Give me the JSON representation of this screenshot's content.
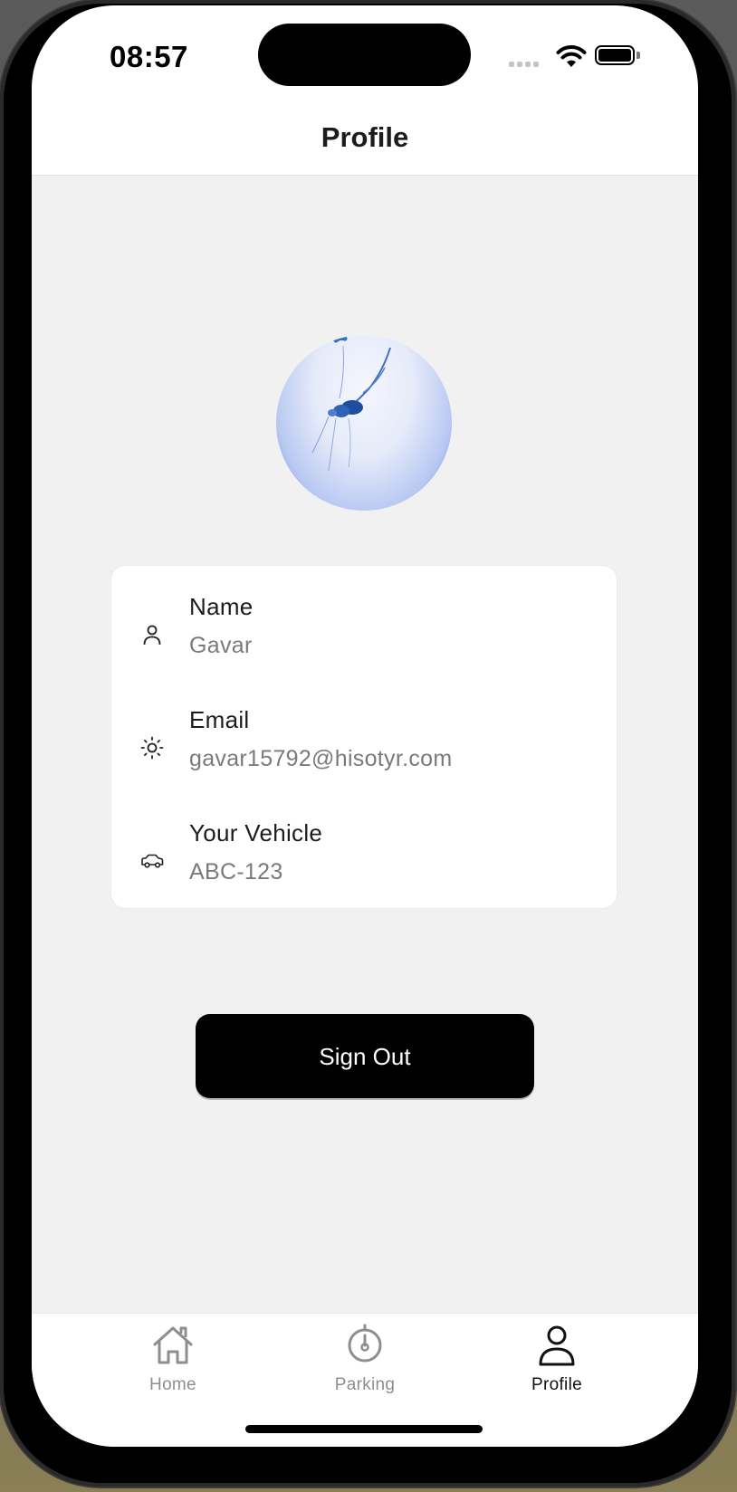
{
  "status_bar": {
    "time": "08:57",
    "signal_icon": "cellular-signal-icon",
    "wifi_icon": "wifi-icon",
    "battery_icon": "battery-icon"
  },
  "header": {
    "title": "Profile"
  },
  "avatar": {
    "icon": "jellyfish-photo"
  },
  "profile_info": {
    "items": [
      {
        "icon": "person-icon",
        "label": "Name",
        "value": "Gavar"
      },
      {
        "icon": "sun-icon",
        "label": "Email",
        "value": "gavar15792@hisotyr.com"
      },
      {
        "icon": "car-icon",
        "label": "Your Vehicle",
        "value": "ABC-123"
      }
    ]
  },
  "actions": {
    "sign_out_label": "Sign Out"
  },
  "tab_bar": {
    "tabs": [
      {
        "icon": "home-icon",
        "label": "Home",
        "active": false
      },
      {
        "icon": "gauge-icon",
        "label": "Parking",
        "active": false
      },
      {
        "icon": "person-icon",
        "label": "Profile",
        "active": true
      }
    ]
  },
  "colors": {
    "background": "#f1f1f1",
    "surface": "#ffffff",
    "button": "#000000",
    "label": "#1c1c1c",
    "secondary_text": "#7a7a7a",
    "inactive_tab": "#8e8e8e"
  }
}
